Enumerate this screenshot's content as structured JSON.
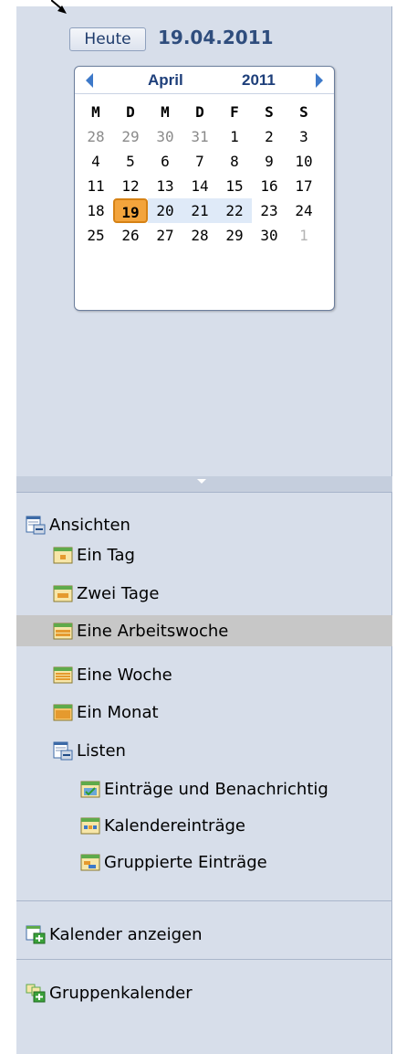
{
  "header": {
    "today_button": "Heute",
    "current_date": "19.04.2011"
  },
  "calendar": {
    "month": "April",
    "year": "2011",
    "weekdays": [
      "M",
      "D",
      "M",
      "D",
      "F",
      "S",
      "S"
    ],
    "weeks": [
      [
        "28",
        "29",
        "30",
        "31",
        "1",
        "2",
        "3"
      ],
      [
        "4",
        "5",
        "6",
        "7",
        "8",
        "9",
        "10"
      ],
      [
        "11",
        "12",
        "13",
        "14",
        "15",
        "16",
        "17"
      ],
      [
        "18",
        "19",
        "20",
        "21",
        "22",
        "23",
        "24"
      ],
      [
        "25",
        "26",
        "27",
        "28",
        "29",
        "30",
        "1"
      ]
    ],
    "selected_day": "19"
  },
  "tree": {
    "ansichten": "Ansichten",
    "ein_tag": "Ein Tag",
    "zwei_tage": "Zwei Tage",
    "arbeitswoche": "Eine Arbeitswoche",
    "woche": "Eine Woche",
    "monat": "Ein Monat",
    "listen": "Listen",
    "eintraege_benachrichtig": "Einträge und Benachrichtig",
    "kalendereintraege": "Kalendereinträge",
    "gruppierte": "Gruppierte Einträge",
    "kalender_anzeigen": "Kalender anzeigen",
    "gruppenkalender": "Gruppenkalender"
  },
  "colors": {
    "panel_bg": "#d7deea",
    "today_highlight": "#f3a43c",
    "selected_row": "#c7c7c7",
    "accent": "#2f4d7d"
  }
}
